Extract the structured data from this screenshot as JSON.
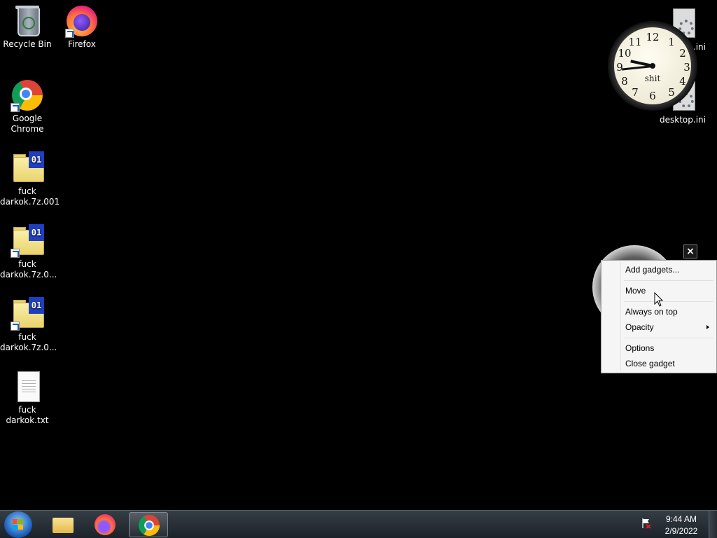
{
  "desktop": {
    "icons": [
      {
        "label": "Recycle Bin",
        "icon": "recycle-bin-icon"
      },
      {
        "label": "Firefox",
        "icon": "firefox-icon"
      },
      {
        "label": "Google Chrome",
        "icon": "chrome-icon"
      },
      {
        "label": "fuck darkok.7z.001",
        "icon": "7z-archive-icon",
        "badge": "01"
      },
      {
        "label": "fuck darkok.7z.0...",
        "icon": "7z-archive-icon",
        "badge": "01"
      },
      {
        "label": "fuck darkok.7z.0...",
        "icon": "7z-archive-icon",
        "badge": "01"
      },
      {
        "label": "fuck darkok.txt",
        "icon": "text-file-icon"
      },
      {
        "label": "desktop.ini",
        "icon": "settings-file-icon"
      },
      {
        "label": "desktop.ini",
        "icon": "settings-file-icon"
      }
    ]
  },
  "clock_gadget": {
    "label": "shit",
    "numbers": [
      "12",
      "1",
      "2",
      "3",
      "4",
      "5",
      "6",
      "7",
      "8",
      "9",
      "10",
      "11"
    ],
    "time": "9:44"
  },
  "gadget_close": "×",
  "context_menu": {
    "items": [
      {
        "label": "Add gadgets..."
      },
      {
        "label": "Move"
      },
      {
        "label": "Always on top"
      },
      {
        "label": "Opacity",
        "submenu": true
      },
      {
        "label": "Options"
      },
      {
        "label": "Close gadget"
      }
    ]
  },
  "taskbar": {
    "pinned": [
      "windows-explorer-icon",
      "firefox-icon",
      "chrome-icon"
    ],
    "active": "chrome-icon",
    "clock": {
      "time": "9:44 AM",
      "date": "2/9/2022"
    },
    "tray": [
      "action-center-flag-icon"
    ]
  },
  "colors": {
    "desktop": "#000000",
    "start_orb": "#1b5fb8",
    "menu_bg": "#f5f5f5"
  }
}
